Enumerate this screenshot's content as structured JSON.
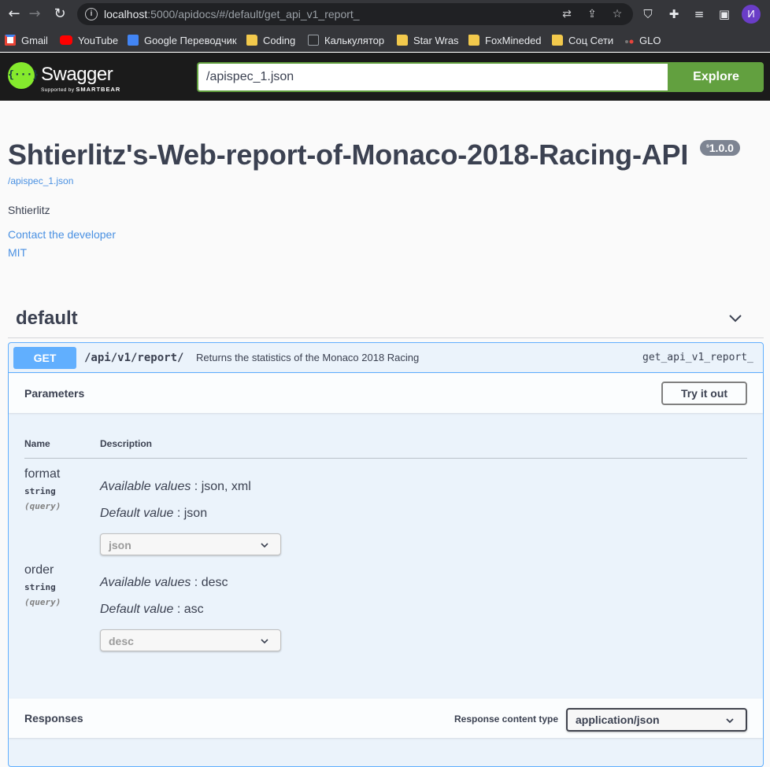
{
  "browser": {
    "url_host": "localhost",
    "url_rest": ":5000/apidocs/#/default/get_api_v1_report_",
    "avatar_letter": "И",
    "bookmarks": [
      {
        "label": "Gmail",
        "icon": "gmail-icon",
        "color": "#ea4335"
      },
      {
        "label": "YouTube",
        "icon": "youtube-icon",
        "color": "#ff0000"
      },
      {
        "label": "Google Переводчик",
        "icon": "translate-icon",
        "color": "#4285f4"
      },
      {
        "label": "Coding",
        "icon": "folder-icon",
        "color": "#f2c94c"
      },
      {
        "label": "Калькулятор",
        "icon": "calculator-icon",
        "color": "#5f6368"
      },
      {
        "label": "Star Wras",
        "icon": "folder-icon",
        "color": "#f2c94c"
      },
      {
        "label": "FoxMineded",
        "icon": "folder-icon",
        "color": "#f2c94c"
      },
      {
        "label": "Соц Сети",
        "icon": "folder-icon",
        "color": "#f2c94c"
      },
      {
        "label": "GLO",
        "icon": "glo-icon",
        "color": "#e8453c"
      }
    ]
  },
  "swagger": {
    "logo_text": "Swagger",
    "logo_sub_prefix": "Supported by",
    "logo_sub_brand": "SMARTBEAR",
    "spec_url": "/apispec_1.json",
    "explore_label": "Explore",
    "accent": "#85ea2d",
    "explore_color": "#62a03f"
  },
  "info": {
    "title": "Shtierlitz's-Web-report-of-Monaco-2018-Racing-API",
    "version": "1.0.0",
    "spec_link": "/apispec_1.json",
    "description": "Shtierlitz",
    "contact": "Contact the developer",
    "license": "MIT"
  },
  "tag": {
    "name": "default"
  },
  "operation": {
    "method": "GET",
    "method_color": "#61affe",
    "path": "/api/v1/report/",
    "summary": "Returns the statistics of the Monaco 2018 Racing",
    "operation_id": "get_api_v1_report_",
    "parameters_title": "Parameters",
    "try_it_out": "Try it out",
    "col_name": "Name",
    "col_description": "Description",
    "parameters": [
      {
        "name": "format",
        "type": "string",
        "in": "(query)",
        "available_label": "Available values",
        "available_values": ": json, xml",
        "default_label": "Default value",
        "default_value": ": json",
        "selected": "json"
      },
      {
        "name": "order",
        "type": "string",
        "in": "(query)",
        "available_label": "Available values",
        "available_values": ": desc",
        "default_label": "Default value",
        "default_value": ": asc",
        "selected": "desc"
      }
    ],
    "responses_title": "Responses",
    "response_content_type_label": "Response content type",
    "response_content_type": "application/json"
  }
}
